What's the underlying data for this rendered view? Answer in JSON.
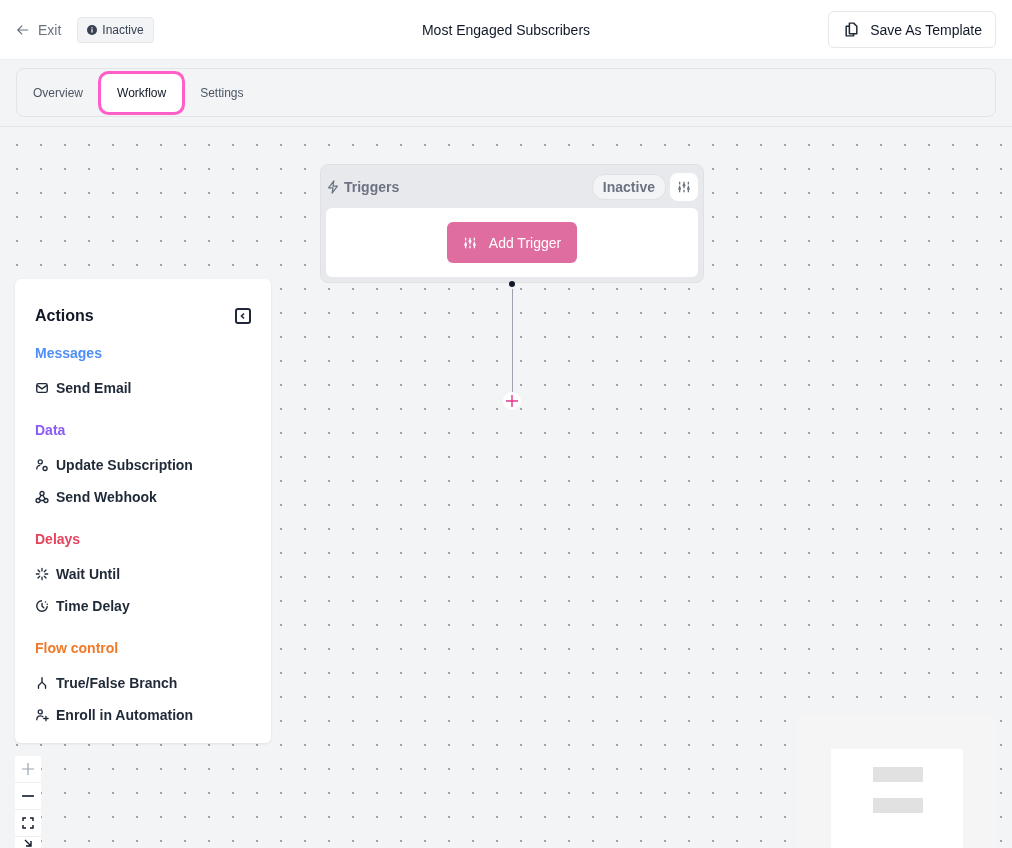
{
  "header": {
    "exit": "Exit",
    "status": "Inactive",
    "title": "Most Engaged Subscribers",
    "save_button": "Save As Template"
  },
  "tabs": [
    {
      "label": "Overview",
      "selected": false
    },
    {
      "label": "Workflow",
      "selected": true
    },
    {
      "label": "Settings",
      "selected": false
    }
  ],
  "trigger_node": {
    "title": "Triggers",
    "status": "Inactive",
    "button": "Add Trigger"
  },
  "actions_panel": {
    "title": "Actions",
    "groups": [
      {
        "label": "Messages",
        "color": "#4f8ef7",
        "items": [
          {
            "label": "Send Email",
            "kind": "mail"
          }
        ]
      },
      {
        "label": "Data",
        "color": "#8b5cf6",
        "items": [
          {
            "label": "Update Subscription",
            "kind": "user-sync"
          },
          {
            "label": "Send Webhook",
            "kind": "webhook"
          }
        ]
      },
      {
        "label": "Delays",
        "color": "#e5445f",
        "items": [
          {
            "label": "Wait Until",
            "kind": "loader"
          },
          {
            "label": "Time Delay",
            "kind": "clock"
          }
        ]
      },
      {
        "label": "Flow control",
        "color": "#f07a2a",
        "items": [
          {
            "label": "True/False Branch",
            "kind": "branch"
          },
          {
            "label": "Enroll in Automation",
            "kind": "user-plus"
          }
        ]
      }
    ]
  }
}
